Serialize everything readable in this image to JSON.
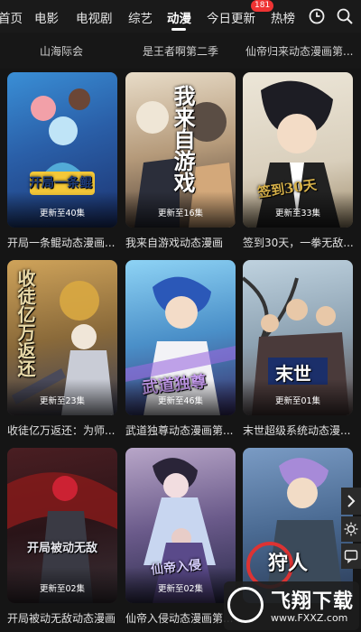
{
  "nav": {
    "tabs": [
      "首页",
      "电影",
      "电视剧",
      "综艺",
      "动漫",
      "今日更新",
      "热榜"
    ],
    "active": "动漫",
    "badge": "181"
  },
  "subrow": [
    "山海际会",
    "是王者啊第二季",
    "仙帝归来动态漫画第..."
  ],
  "cards": [
    {
      "title": "开局一条鲲动态漫画...",
      "episode": "更新至40集",
      "art": "开局一条鲲"
    },
    {
      "title": "我来自游戏动态漫画",
      "episode": "更新至16集",
      "art": "我来自游戏"
    },
    {
      "title": "签到30天，一拳无敌...",
      "episode": "更新至33集",
      "art": "签到30天"
    },
    {
      "title": "收徒亿万返还：为师...",
      "episode": "更新至23集",
      "art": "收徒亿万返还"
    },
    {
      "title": "武道独尊动态漫画第...",
      "episode": "更新至46集",
      "art": "武道独尊"
    },
    {
      "title": "末世超级系统动态漫...",
      "episode": "更新至01集",
      "art": "末世"
    },
    {
      "title": "开局被动无敌动态漫画",
      "episode": "更新至02集",
      "art": "开局被动无敌"
    },
    {
      "title": "仙帝入侵动态漫画第...",
      "episode": "更新至02集",
      "art": "仙帝入侵"
    },
    {
      "title": "",
      "episode": "",
      "art": "狩人"
    }
  ],
  "watermark": {
    "name": "飞翔下载",
    "url": "www.FXXZ.com"
  },
  "colors": {
    "background": "#151515",
    "badge": "#e33333"
  }
}
